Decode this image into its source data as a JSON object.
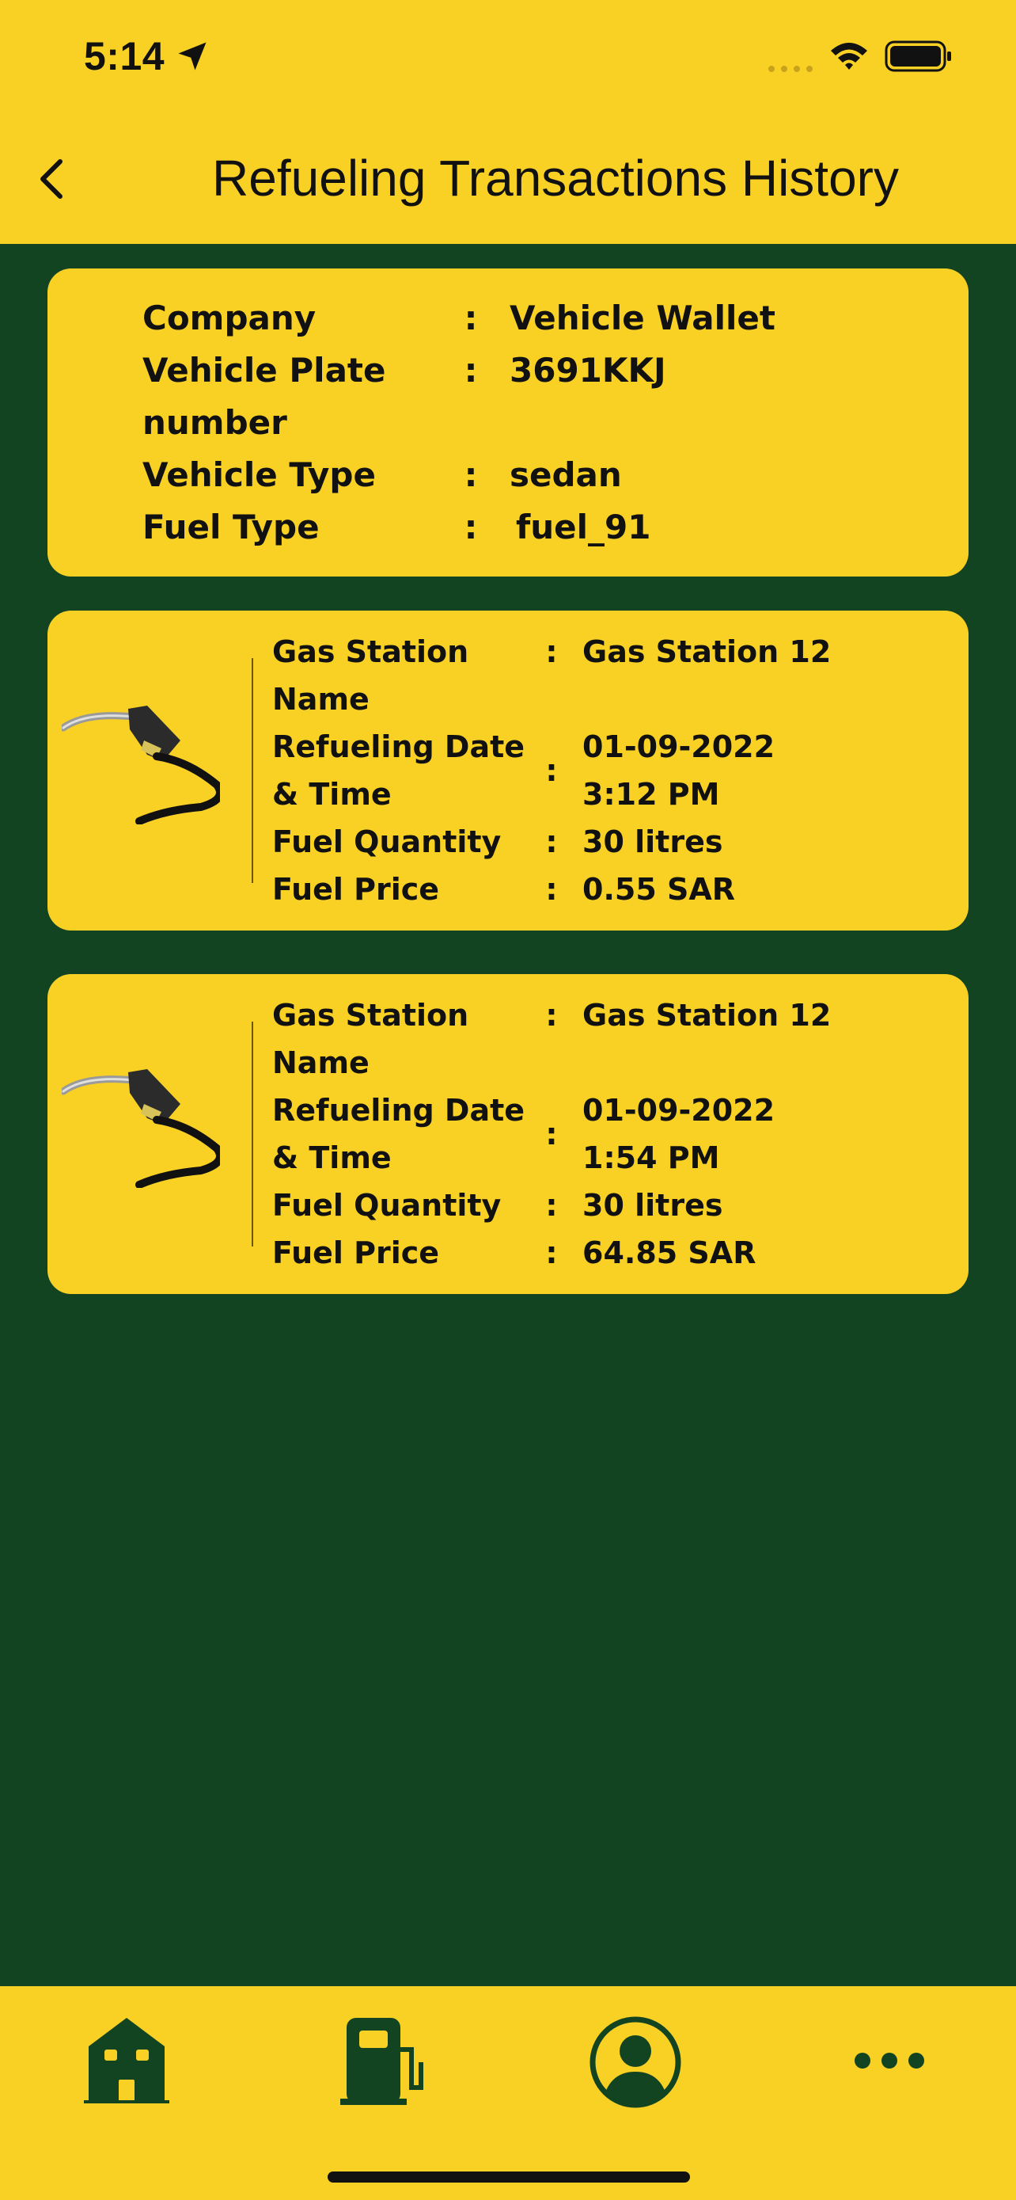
{
  "status_bar": {
    "time": "5:14"
  },
  "header": {
    "title": "Refueling Transactions History",
    "back_icon": "chevron-left-icon"
  },
  "vehicle_info": {
    "rows": [
      {
        "label": "Company",
        "value": "Vehicle Wallet"
      },
      {
        "label": "Vehicle Plate number",
        "value": "3691KKJ"
      },
      {
        "label": "Vehicle Type",
        "value": "sedan"
      },
      {
        "label": "Fuel Type",
        "value": "fuel_91"
      }
    ]
  },
  "transactions": [
    {
      "station_label": "Gas Station Name",
      "station": "Gas Station 12",
      "date_label": "Refueling Date & Time",
      "date": "01-09-2022",
      "time": "3:12 PM",
      "quantity_label": "Fuel Quantity",
      "quantity": "30 litres",
      "price_label": "Fuel Price",
      "price": "0.55 SAR"
    },
    {
      "station_label": "Gas Station Name",
      "station": "Gas Station 12",
      "date_label": "Refueling Date & Time",
      "date": "01-09-2022",
      "time": "1:54 PM",
      "quantity_label": "Fuel Quantity",
      "quantity": "30 litres",
      "price_label": "Fuel Price",
      "price": "64.85 SAR"
    }
  ],
  "separator": ":",
  "tab_bar": {
    "items": [
      {
        "icon": "home-icon"
      },
      {
        "icon": "fuel-pump-icon"
      },
      {
        "icon": "profile-icon"
      },
      {
        "icon": "more-icon"
      }
    ]
  },
  "colors": {
    "accent_yellow": "#f9d125",
    "background_green": "#134421",
    "text": "#111111"
  }
}
